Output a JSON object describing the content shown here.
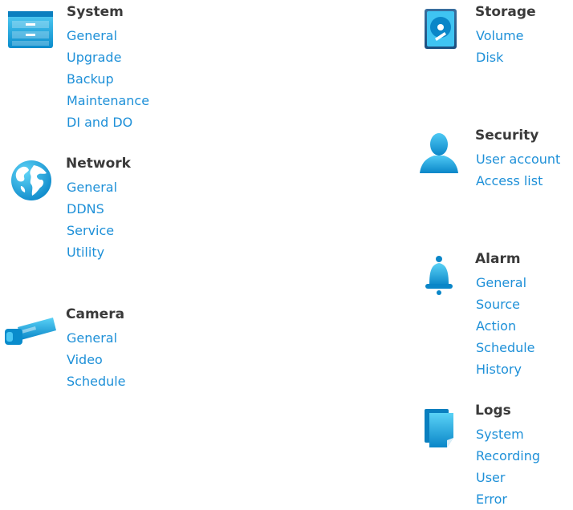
{
  "sections": {
    "system": {
      "title": "System",
      "icon": "cabinet-icon",
      "links": [
        "General",
        "Upgrade",
        "Backup",
        "Maintenance",
        "DI and DO"
      ]
    },
    "network": {
      "title": "Network",
      "icon": "globe-icon",
      "links": [
        "General",
        "DDNS",
        "Service",
        "Utility"
      ]
    },
    "camera": {
      "title": "Camera",
      "icon": "camera-icon",
      "links": [
        "General",
        "Video",
        "Schedule"
      ]
    },
    "storage": {
      "title": "Storage",
      "icon": "hard-disk-icon",
      "links": [
        "Volume",
        "Disk"
      ]
    },
    "security": {
      "title": "Security",
      "icon": "user-icon",
      "links": [
        "User account",
        "Access list"
      ]
    },
    "alarm": {
      "title": "Alarm",
      "icon": "bell-icon",
      "links": [
        "General",
        "Source",
        "Action",
        "Schedule",
        "History"
      ]
    },
    "logs": {
      "title": "Logs",
      "icon": "document-icon",
      "links": [
        "System",
        "Recording",
        "User",
        "Error"
      ]
    }
  },
  "colors": {
    "accent": "#1e90d8",
    "icon_light": "#4cc8f4",
    "icon_dark": "#0a86c8",
    "heading": "#3a3a3a"
  }
}
